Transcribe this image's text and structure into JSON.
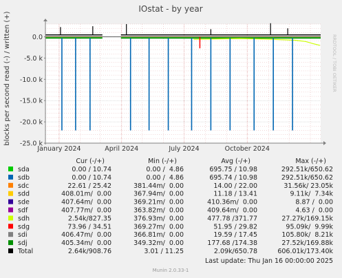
{
  "chart_data": {
    "type": "line",
    "title": "IOstat - by year",
    "ylabel": "blocks per second read (-) / written (+)",
    "side_label": "RRDTOOL / TOBI OETIKER",
    "footer": "Munin 2.0.33-1",
    "last_update": "Last update:  Thu Jan 16 00:00:00 2025",
    "ylim": [
      -25000,
      3000
    ],
    "y_ticks": [
      0,
      -5000,
      -10000,
      -15000,
      -20000,
      -25000
    ],
    "y_tick_labels": [
      "0.0",
      "-5.0 k",
      "-10.0 k",
      "-15.0 k",
      "-20.0 k",
      "-25.0 k"
    ],
    "x_range": [
      "2023-12-12",
      "2025-01-16"
    ],
    "x_ticks": [
      "2024-01-01",
      "2024-04-01",
      "2024-07-01",
      "2024-10-01"
    ],
    "x_tick_labels": [
      "January 2024",
      "April 2024",
      "July 2024",
      "October 2024"
    ],
    "grid": true,
    "colors": {
      "background": "#f0f0f0",
      "plot": "#ffffff",
      "grid_minor": "#e6b0b0",
      "grid_major": "#d0d0d0",
      "axis": "#808080",
      "zero_line": "#000000",
      "read_spikes": "#0066b3",
      "total": "#000000",
      "sdh": "#ccff00",
      "sdg": "#ff0000",
      "sdj": "#008f00"
    },
    "legend_headers": {
      "cur": "Cur (-/+)",
      "min": "Min (-/+)",
      "avg": "Avg (-/+)",
      "max": "Max (-/+)"
    },
    "series": [
      {
        "name": "sda",
        "color": "#00cc00",
        "cur": "0.00 / 10.74",
        "min": "0.00 /  4.86",
        "avg": "695.75 / 10.98",
        "max": "292.51k/650.62"
      },
      {
        "name": "sdb",
        "color": "#0066b3",
        "cur": "0.00 / 10.74",
        "min": "0.00 /  4.86",
        "avg": "695.74 / 10.98",
        "max": "292.51k/650.62"
      },
      {
        "name": "sdc",
        "color": "#ff8000",
        "cur": "22.61 / 25.42",
        "min": "381.44m/  0.00",
        "avg": "14.00 / 22.00",
        "max": "31.56k/ 23.05k"
      },
      {
        "name": "sdd",
        "color": "#ffcc00",
        "cur": "408.01m/  0.00",
        "min": "367.94m/  0.00",
        "avg": "11.18 / 13.41",
        "max": "9.11k/  7.34k"
      },
      {
        "name": "sde",
        "color": "#330099",
        "cur": "407.64m/  0.00",
        "min": "369.21m/  0.00",
        "avg": "410.36m/  0.00",
        "max": "8.87 /  0.00"
      },
      {
        "name": "sdf",
        "color": "#990099",
        "cur": "407.77m/  0.00",
        "min": "363.82m/  0.00",
        "avg": "409.64m/  0.00",
        "max": "4.63 /  0.00"
      },
      {
        "name": "sdh",
        "color": "#ccff00",
        "cur": "2.54k/827.35",
        "min": "376.93m/  0.00",
        "avg": "477.78 /371.77",
        "max": "27.27k/169.15k"
      },
      {
        "name": "sdg",
        "color": "#ff0000",
        "cur": "73.96 / 34.51",
        "min": "369.27m/  0.00",
        "avg": "51.95 / 29.82",
        "max": "95.09k/  9.99k"
      },
      {
        "name": "sdi",
        "color": "#808080",
        "cur": "406.47m/  0.00",
        "min": "366.81m/  0.00",
        "avg": "19.59 / 17.45",
        "max": "105.80k/  8.21k"
      },
      {
        "name": "sdj",
        "color": "#008f00",
        "cur": "405.34m/  0.00",
        "min": "349.32m/  0.00",
        "avg": "177.68 /174.38",
        "max": "27.52k/169.88k"
      },
      {
        "name": "Total",
        "color": "#000000",
        "cur": "2.64k/908.76",
        "min": "3.01 / 11.25",
        "avg": "2.09k/650.78",
        "max": "606.01k/173.40k"
      }
    ],
    "read_spikes": [
      {
        "date": "2024-01-05",
        "value": -22000
      },
      {
        "date": "2024-01-25",
        "value": -22000
      },
      {
        "date": "2024-02-15",
        "value": -22000
      },
      {
        "date": "2024-04-14",
        "value": -22000
      },
      {
        "date": "2024-05-11",
        "value": -22000
      },
      {
        "date": "2024-06-08",
        "value": -22000
      },
      {
        "date": "2024-07-12",
        "value": -22000
      },
      {
        "date": "2024-08-09",
        "value": -22000
      },
      {
        "date": "2024-09-06",
        "value": -22000
      },
      {
        "date": "2024-10-11",
        "value": -22000
      },
      {
        "date": "2024-11-08",
        "value": -22000
      },
      {
        "date": "2024-12-06",
        "value": -22000
      }
    ],
    "gaps": [
      [
        "2024-03-04",
        "2024-03-31"
      ]
    ],
    "total_write_spikes": [
      {
        "date": "2024-01-03",
        "value": 2300
      },
      {
        "date": "2024-02-19",
        "value": 2500
      },
      {
        "date": "2024-04-08",
        "value": 3000
      },
      {
        "date": "2024-08-09",
        "value": 1800
      },
      {
        "date": "2024-11-04",
        "value": 3200
      },
      {
        "date": "2024-11-29",
        "value": 2000
      }
    ],
    "sdg_spike": {
      "date": "2024-07-24",
      "value": -2700
    },
    "sdh_points": [
      {
        "date": "2024-07-15",
        "value": -600
      },
      {
        "date": "2024-08-15",
        "value": -500
      },
      {
        "date": "2024-09-20",
        "value": -400
      },
      {
        "date": "2024-10-20",
        "value": -500
      },
      {
        "date": "2024-11-25",
        "value": -700
      },
      {
        "date": "2024-12-10",
        "value": -800
      },
      {
        "date": "2024-12-25",
        "value": -1100
      },
      {
        "date": "2025-01-05",
        "value": -1600
      },
      {
        "date": "2025-01-15",
        "value": -2000
      }
    ]
  }
}
